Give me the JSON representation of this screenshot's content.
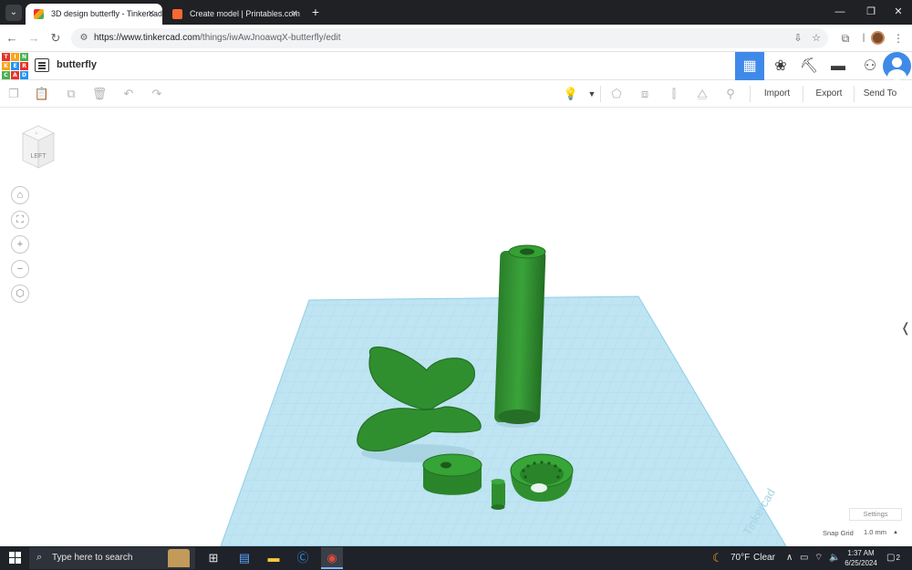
{
  "browser": {
    "tabs": [
      {
        "title": "3D design butterfly - Tinkercad",
        "active": true
      },
      {
        "title": "Create model | Printables.com",
        "active": false
      }
    ],
    "url_host": "https://www.tinkercad.com",
    "url_path": "/things/iwAwJnoawqX-butterfly/edit",
    "new_tab": "+",
    "window_controls": {
      "minimize": "—",
      "maximize": "❐",
      "close": "✕"
    }
  },
  "app": {
    "logo_letters": [
      "T",
      "I",
      "N",
      "K",
      "E",
      "R",
      "C",
      "A",
      "D"
    ],
    "design_title": "butterfly",
    "toolbar": {
      "import_label": "Import",
      "export_label": "Export",
      "send_to_label": "Send To"
    }
  },
  "workspace": {
    "view_cube_label": "LEFT",
    "settings_label": "Settings",
    "snap_grid_label": "Snap Grid",
    "snap_grid_value": "1.0 mm",
    "colors": {
      "grid": "#bfe4f2",
      "grid_lines": "#8fcde6",
      "shape": "#2f8f2f"
    }
  },
  "taskbar": {
    "search_placeholder": "Type here to search",
    "weather_temp": "70°F",
    "weather_label": "Clear",
    "time": "1:37 AM",
    "date": "6/25/2024",
    "notification_count": "2"
  }
}
